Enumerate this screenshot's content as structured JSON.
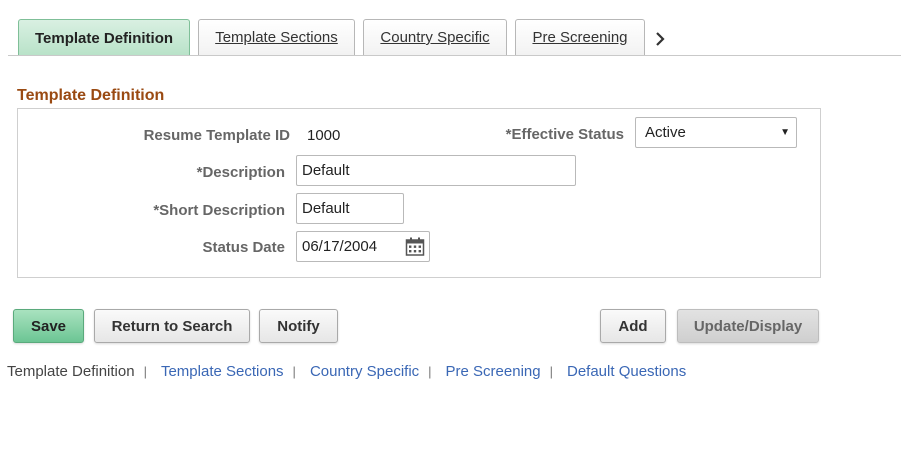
{
  "tabs": [
    {
      "label": "Template Definition",
      "active": true
    },
    {
      "label": "Template Sections",
      "active": false
    },
    {
      "label": "Country Specific",
      "active": false
    },
    {
      "label": "Pre Screening",
      "active": false
    }
  ],
  "tab_next_icon": "chevron-right-icon",
  "section": {
    "title": "Template Definition",
    "resume_template_id_label": "Resume Template ID",
    "resume_template_id_value": "1000",
    "effective_status_label": "*Effective Status",
    "effective_status_value": "Active",
    "description_label": "*Description",
    "description_value": "Default",
    "short_description_label": "*Short Description",
    "short_description_value": "Default",
    "status_date_label": "Status Date",
    "status_date_value": "06/17/2004",
    "calendar_icon": "calendar-icon"
  },
  "buttons": {
    "save": "Save",
    "return_to_search": "Return to Search",
    "notify": "Notify",
    "add": "Add",
    "update_display": "Update/Display"
  },
  "bottom_links": {
    "current": "Template Definition",
    "links": [
      "Template Sections",
      "Country Specific",
      "Pre Screening",
      "Default Questions"
    ],
    "separator": "|"
  },
  "colors": {
    "active_tab": "#b8e2c8",
    "section_title": "#9a4a12",
    "link": "#3a67b5",
    "save_button": "#6cc594"
  }
}
